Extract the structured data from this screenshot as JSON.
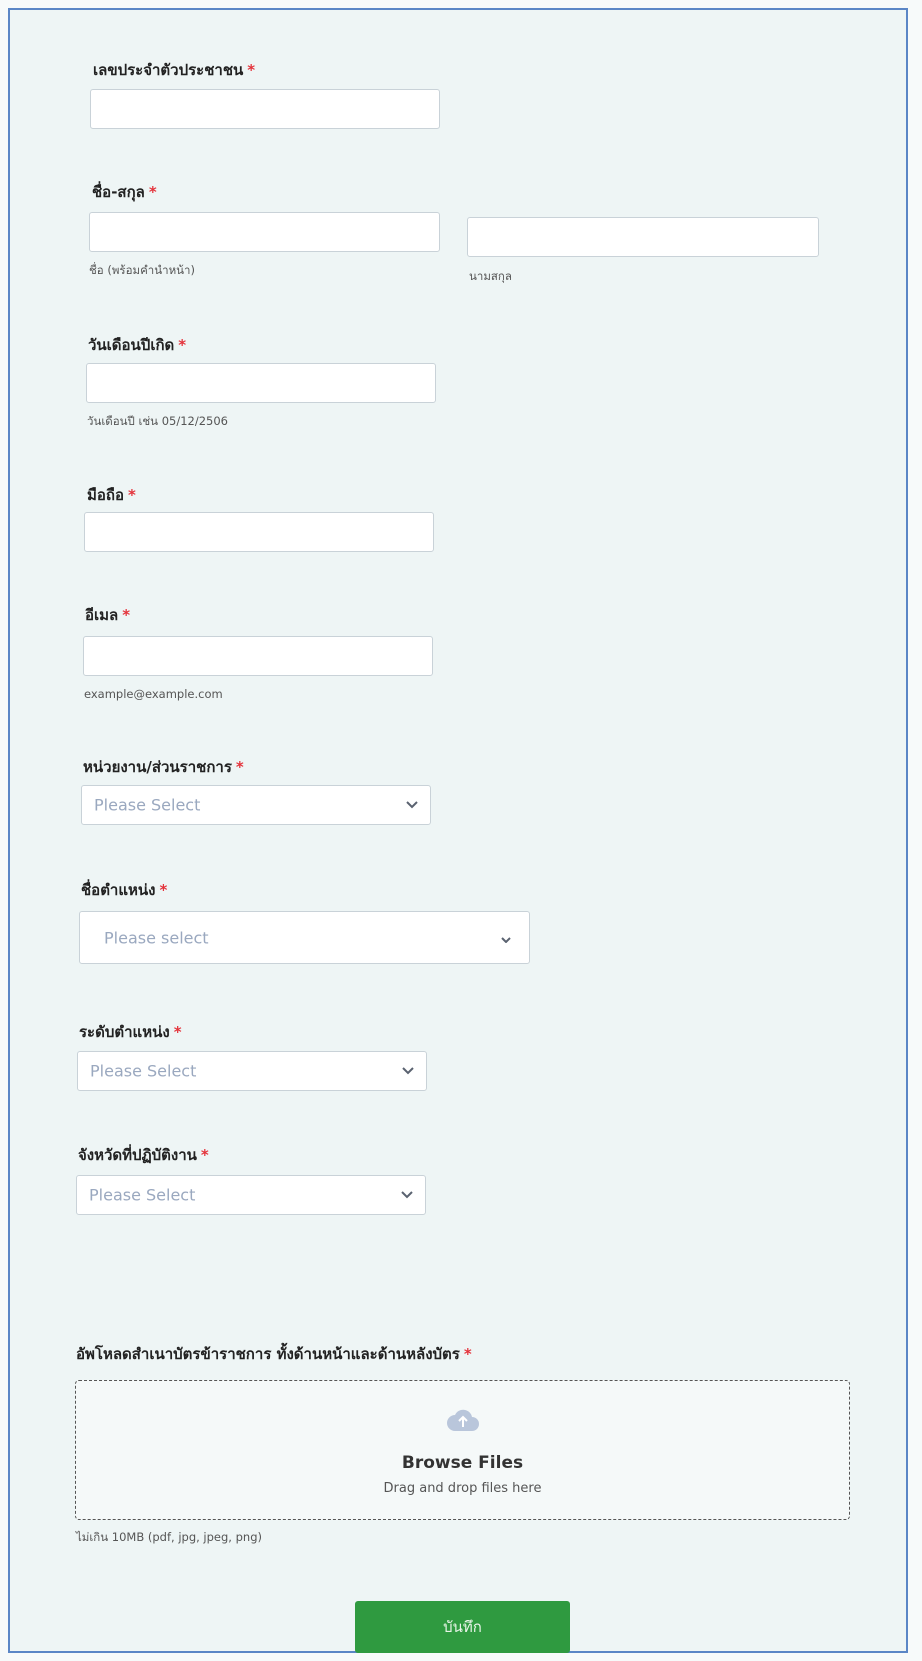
{
  "fields": {
    "id_card": {
      "label": "เลขประจำตัวประชาชน",
      "required": "*"
    },
    "name": {
      "label": "ชื่อ-สกุล",
      "required": "*",
      "first_hint": "ชื่อ (พร้อมคำนำหน้า)",
      "last_hint": "นามสกุล"
    },
    "birthdate": {
      "label": "วันเดือนปีเกิด",
      "required": "*",
      "hint": "วันเดือนปี เช่น 05/12/2506"
    },
    "mobile": {
      "label": "มือถือ",
      "required": "*"
    },
    "email": {
      "label": "อีเมล",
      "required": "*",
      "hint": "example@example.com"
    },
    "department": {
      "label": "หน่วยงาน/ส่วนราชการ",
      "required": "*",
      "placeholder": "Please Select"
    },
    "position": {
      "label": "ชื่อตำแหน่ง",
      "required": "*",
      "placeholder": "Please select"
    },
    "level": {
      "label": "ระดับตำแหน่ง",
      "required": "*",
      "placeholder": "Please Select"
    },
    "province": {
      "label": "จังหวัดที่ปฏิบัติงาน",
      "required": "*",
      "placeholder": "Please Select"
    },
    "upload": {
      "label": "อัพโหลดสำเนาบัตรข้าราชการ ทั้งด้านหน้าและด้านหลังบัตร",
      "required": "*",
      "browse": "Browse Files",
      "drag": "Drag and drop files here",
      "hint": "ไม่เกิน 10MB (pdf, jpg, jpeg, png)"
    }
  },
  "submit_label": "บันทึก",
  "colors": {
    "required": "#e4333b",
    "submit": "#2f9a40",
    "border": "#5b86c6"
  }
}
